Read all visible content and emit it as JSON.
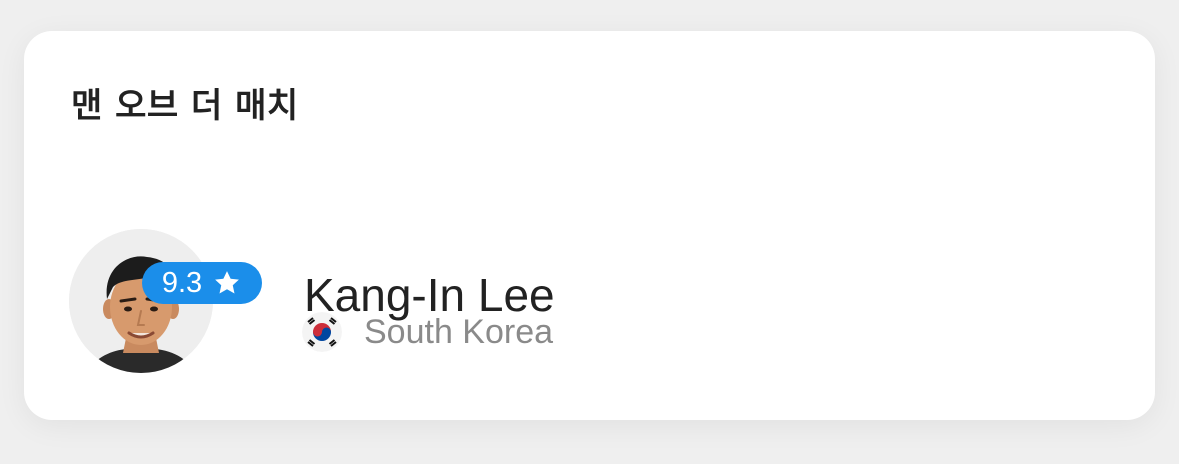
{
  "card": {
    "title": "맨 오브 더 매치"
  },
  "player": {
    "name": "Kang-In Lee",
    "rating": "9.3",
    "rating_icon": "star-icon",
    "country": "South Korea",
    "flag_icon": "south-korea-flag-icon",
    "avatar_icon": "player-photo"
  },
  "colors": {
    "background": "#efefef",
    "card": "#ffffff",
    "rating_badge": "#1b8eea",
    "name_text": "#222222",
    "country_text": "#8a8a8a"
  }
}
